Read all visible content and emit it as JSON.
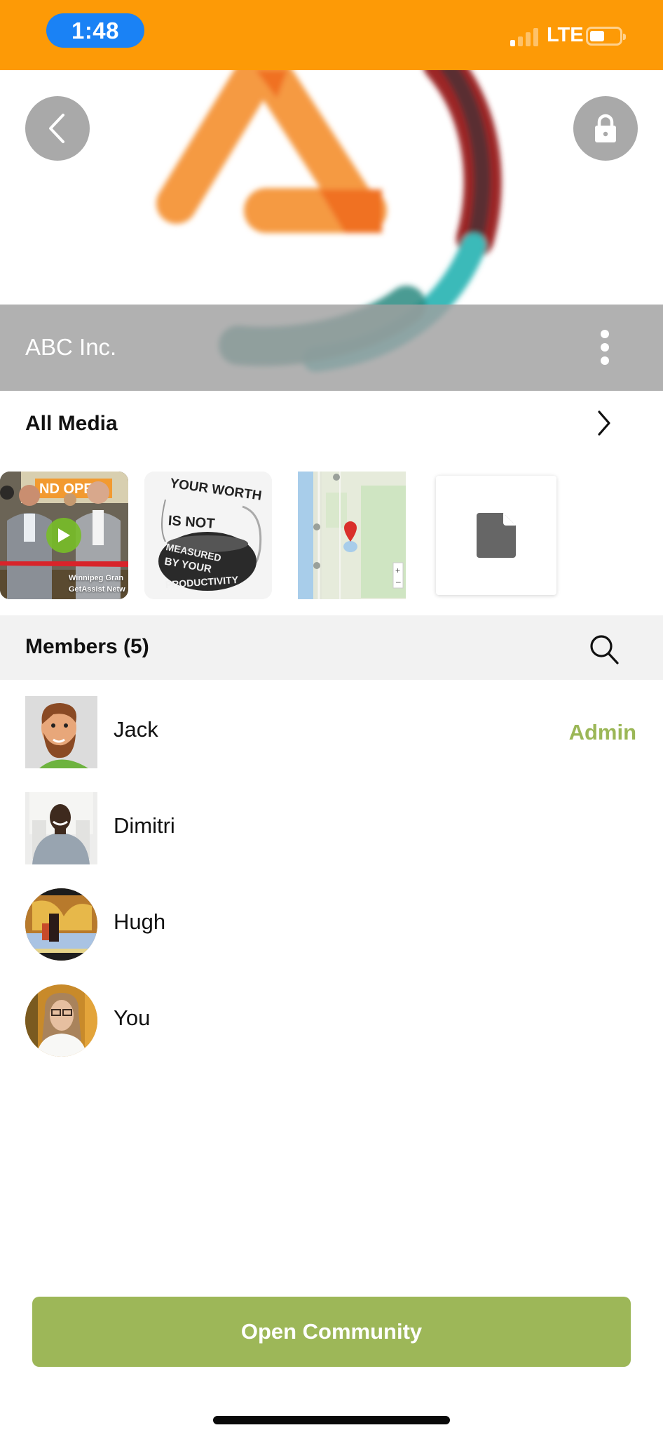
{
  "status_bar": {
    "time": "1:48",
    "network": "LTE",
    "signal_bars_active": 1,
    "signal_bars_total": 4,
    "battery_level": 0.4,
    "background_color": "#fd9a06"
  },
  "cover": {
    "back_icon": "chevron-left-icon",
    "lock_icon": "lock-icon",
    "community_name": "ABC Inc.",
    "more_icon": "more-vertical-icon"
  },
  "media": {
    "title": "All Media",
    "chevron_icon": "chevron-right-icon",
    "items": [
      {
        "type": "video",
        "caption_line1": "Winnipeg Gran",
        "caption_line2": "GetAssist Netw",
        "banner_text": "ND OPE"
      },
      {
        "type": "image",
        "text_lines": [
          "YOUR WORTH",
          "IS NOT",
          "MEASURED",
          "BY YOUR",
          "PRODUCTIVITY"
        ]
      },
      {
        "type": "map"
      },
      {
        "type": "file",
        "icon": "file-icon"
      }
    ]
  },
  "members": {
    "title": "Members (5)",
    "search_icon": "search-icon",
    "list": [
      {
        "name": "Jack",
        "role": "Admin",
        "avatar_shape": "square"
      },
      {
        "name": "Dimitri",
        "role": "",
        "avatar_shape": "square"
      },
      {
        "name": "Hugh",
        "role": "",
        "avatar_shape": "round"
      },
      {
        "name": "You",
        "role": "",
        "avatar_shape": "round"
      }
    ]
  },
  "actions": {
    "open_community_label": "Open Community",
    "accent_color": "#9db758"
  }
}
